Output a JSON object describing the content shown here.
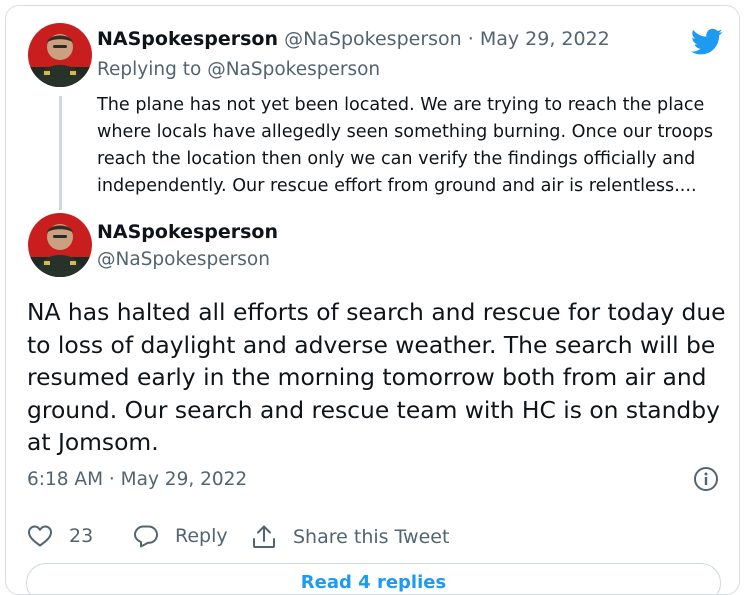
{
  "tweet1": {
    "display_name": "NASpokesperson",
    "handle": "@NaSpokesperson",
    "separator": " · ",
    "date": "May 29, 2022",
    "replying_to_prefix": "Replying to ",
    "replying_to_handle": "@NaSpokesperson",
    "text": "The plane has not yet been located. We are trying to reach the place where locals have allegedly seen something burning. Once our troops reach the location then only we can verify the findings officially and independently. Our rescue effort from ground and air is relentless...."
  },
  "tweet2": {
    "display_name": "NASpokesperson",
    "handle": "@NaSpokesperson",
    "text": "NA has halted all efforts of search and rescue for today due to loss of daylight and adverse weather. The search will be resumed early in the morning tomorrow both from air and ground. Our search and rescue team with HC is on standby at Jomsom.",
    "timestamp": "6:18 AM · May 29, 2022",
    "like_count": "23",
    "reply_label": "Reply",
    "share_label": "Share this Tweet",
    "read_replies_label": "Read 4 replies"
  },
  "icons": {
    "brand": "twitter-bird-icon",
    "info": "info-icon",
    "like": "heart-icon",
    "reply": "reply-bubble-icon",
    "share": "share-icon"
  },
  "colors": {
    "accent": "#1d9bf0",
    "muted_text": "#536471",
    "border": "#cfd9de",
    "text": "#0f1419"
  }
}
